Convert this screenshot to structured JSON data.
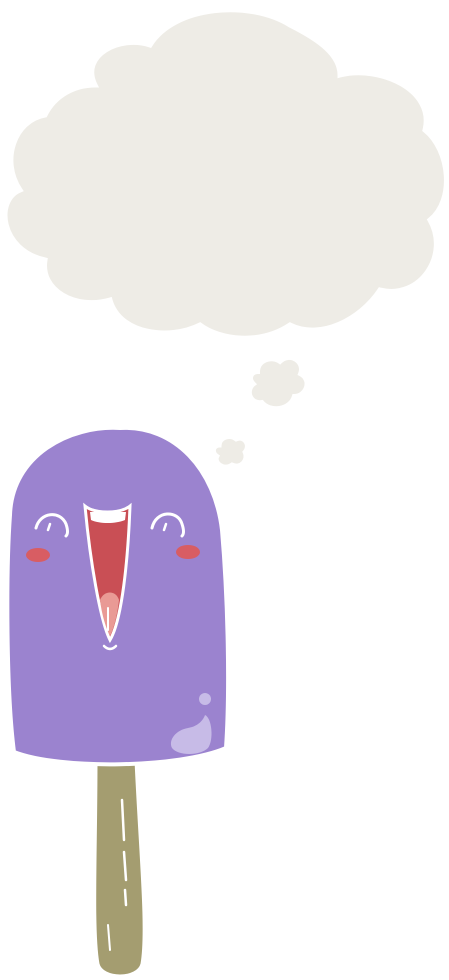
{
  "illustration": {
    "subject": "happy-popsicle-with-thought-bubble",
    "colors": {
      "background": "#ffffff",
      "bubble_fill": "#eeece6",
      "outline": "#ffffff",
      "popsicle_body": "#9b83cf",
      "highlight": "#c7bbe7",
      "stick": "#a49d70",
      "mouth": "#c94f55",
      "tongue": "#e99a95",
      "teeth": "#ffffff",
      "cheeks": "#d85d63",
      "eye_lines": "#ffffff"
    }
  }
}
